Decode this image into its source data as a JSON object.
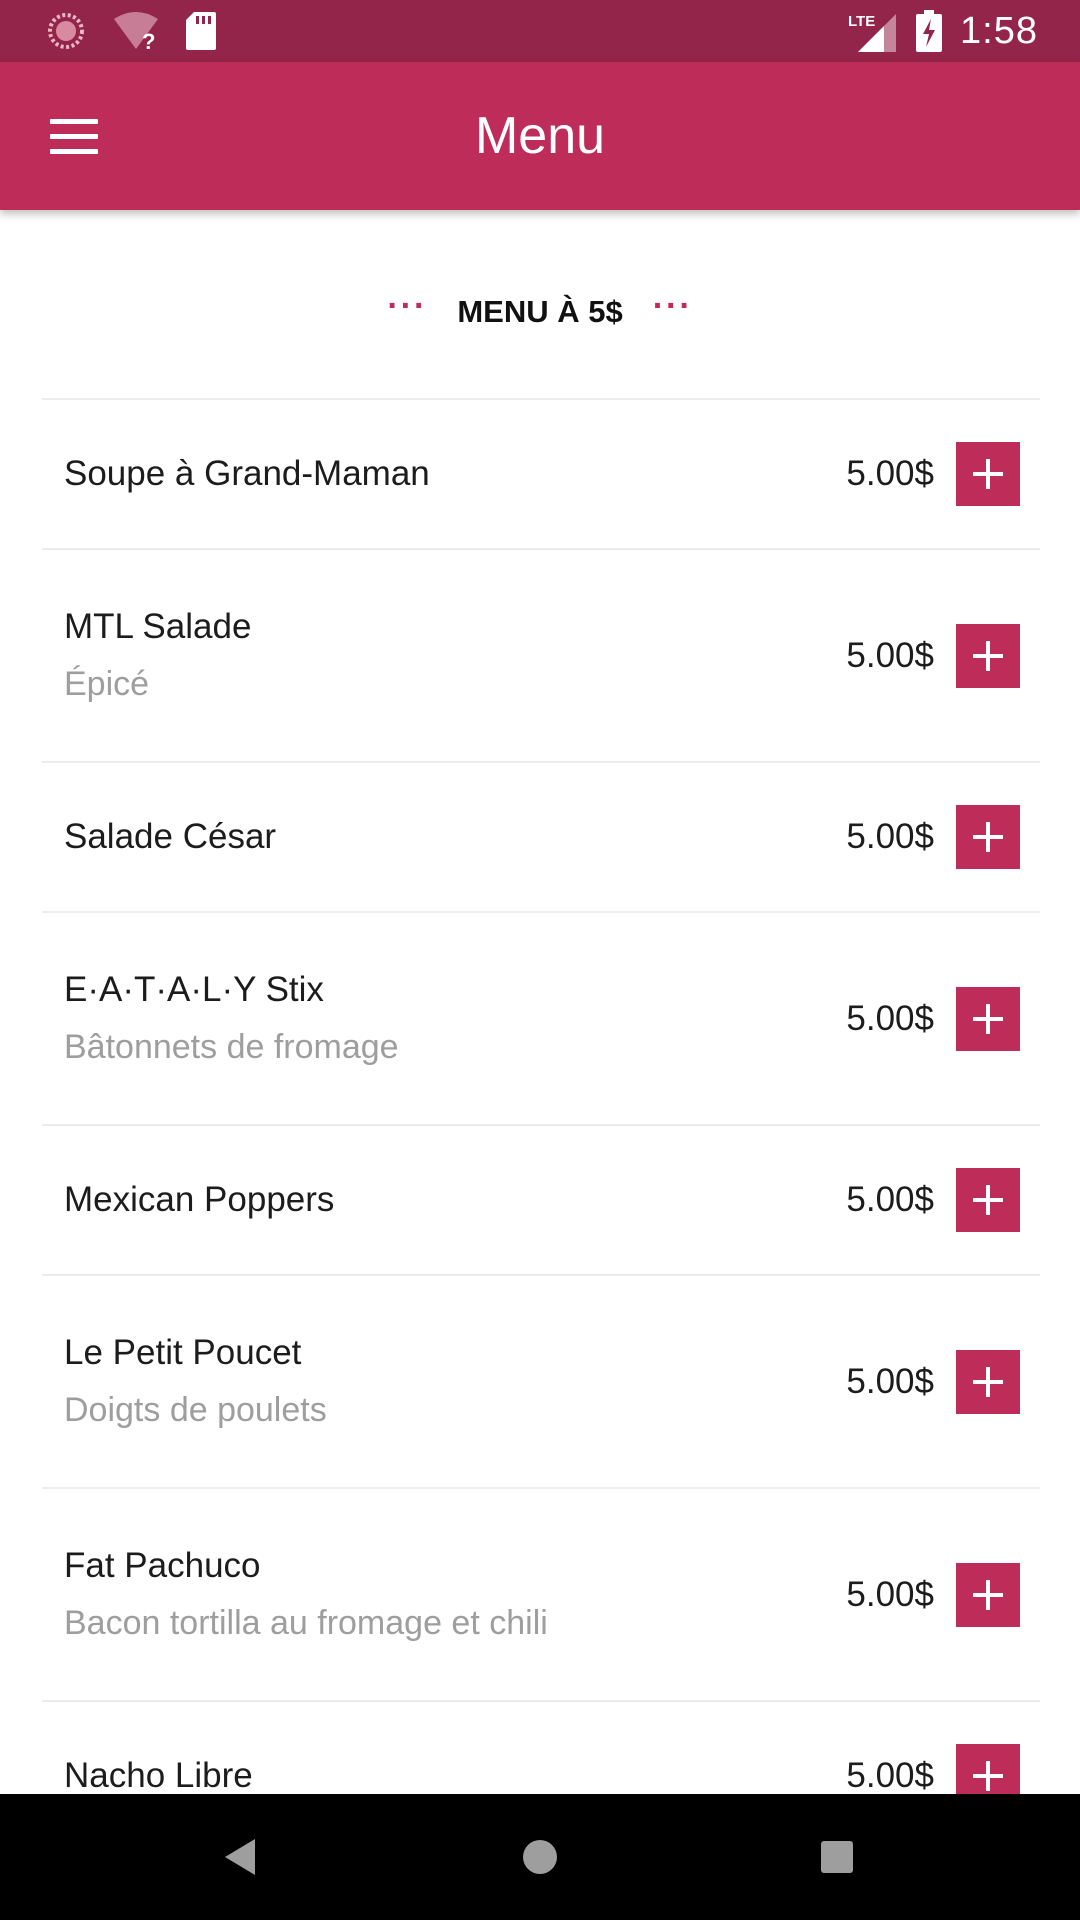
{
  "status_bar": {
    "time": "1:58",
    "network_label": "LTE",
    "icons": [
      "sync-icon",
      "wifi-unknown-icon",
      "sd-card-icon",
      "lte-signal-icon",
      "battery-charging-icon"
    ]
  },
  "app_bar": {
    "title": "Menu",
    "menu_icon": "hamburger-menu-icon"
  },
  "section": {
    "title": "MENU À 5$",
    "decoration": "···"
  },
  "items": [
    {
      "name": "Soupe à Grand-Maman",
      "description": "",
      "price": "5.00$"
    },
    {
      "name": "MTL Salade",
      "description": "Épicé",
      "price": "5.00$"
    },
    {
      "name": "Salade César",
      "description": "",
      "price": "5.00$"
    },
    {
      "name": "E·A·T·A·L·Y Stix",
      "description": "Bâtonnets de fromage",
      "price": "5.00$"
    },
    {
      "name": "Mexican Poppers",
      "description": "",
      "price": "5.00$"
    },
    {
      "name": "Le Petit Poucet",
      "description": "Doigts de poulets",
      "price": "5.00$"
    },
    {
      "name": "Fat Pachuco",
      "description": "Bacon tortilla au fromage et chili",
      "price": "5.00$"
    },
    {
      "name": "Nacho Libre",
      "description": "",
      "price": "5.00$"
    }
  ],
  "nav_bar": {
    "icons": [
      "back-icon",
      "home-icon",
      "recents-icon"
    ]
  },
  "colors": {
    "status_bar": "#93244a",
    "app_bar": "#be2c59",
    "accent": "#be2c59",
    "description_text": "#9e9e9e",
    "divider": "#ececec"
  }
}
